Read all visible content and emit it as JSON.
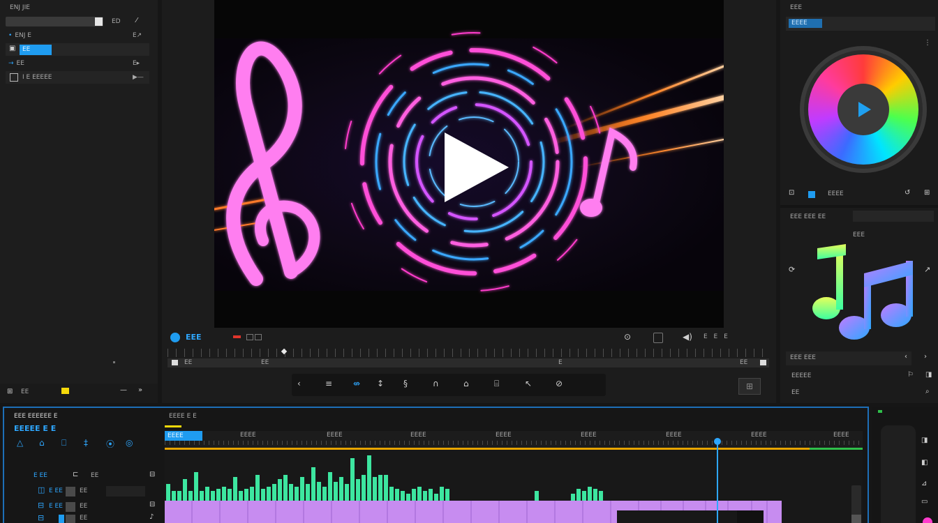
{
  "app": {
    "project_label": "ENJ JIE"
  },
  "left_panel": {
    "header_label": "ENJ JIE",
    "header_right": "ED",
    "rows": [
      {
        "label": "ENJ E",
        "right": "E↗"
      },
      {
        "label": "",
        "value": "EE",
        "highlight": true
      },
      {
        "label": "EE",
        "right": "E▸"
      },
      {
        "label": "I E EEEEE",
        "right": "▶—"
      }
    ],
    "footer_label": "EE"
  },
  "preview": {
    "title": "EEE",
    "timecode_labels": [
      "EE",
      "EE",
      "E",
      "EE"
    ],
    "toolbar_right": "E E E",
    "tools": [
      "‹",
      "≡",
      "⇎",
      "↕",
      "§",
      "∩",
      "⌂",
      "⌸",
      "↖",
      "⊘"
    ]
  },
  "right_panel": {
    "top_label": "EEE",
    "top_field": "EEEE",
    "mid_label": "EEE EEE EE",
    "badge": "EEE",
    "foot_field": "EEE EEE",
    "foot_row1": "EEEEE",
    "foot_row2": "EE",
    "play_label": "Play"
  },
  "timeline": {
    "title": "EEE EEEEEE E",
    "subtitle": "EEEEE E E",
    "ruler_label": "EEEE E E",
    "marker_tab": "EEEE",
    "ruler_ticks": [
      "EEEE",
      "EEEE",
      "EEEE",
      "EEEE",
      "EEEE",
      "EEEE",
      "EEEE",
      "EEEE"
    ],
    "track_labels": [
      "E EE",
      "EE",
      "EE",
      "EE"
    ],
    "icons": [
      "△",
      "⌂",
      "⎕",
      "‡",
      "⦿",
      "◎"
    ]
  },
  "colors": {
    "accent": "#2ea7ff",
    "waveform": "#3de6a0",
    "clip": "#c78cf0",
    "playhead": "#2ea7ff",
    "timeline_top": "#f0a500"
  },
  "waveform_levels": [
    0.35,
    0.2,
    0.2,
    0.45,
    0.2,
    0.6,
    0.2,
    0.3,
    0.2,
    0.25,
    0.3,
    0.25,
    0.5,
    0.2,
    0.25,
    0.3,
    0.55,
    0.25,
    0.3,
    0.35,
    0.45,
    0.55,
    0.35,
    0.3,
    0.5,
    0.35,
    0.7,
    0.4,
    0.3,
    0.6,
    0.4,
    0.5,
    0.35,
    0.9,
    0.45,
    0.55,
    0.95,
    0.5,
    0.55,
    0.55,
    0.3,
    0.25,
    0.2,
    0.15,
    0.25,
    0.3,
    0.2,
    0.25,
    0.15,
    0.3,
    0.25,
    0.2
  ]
}
